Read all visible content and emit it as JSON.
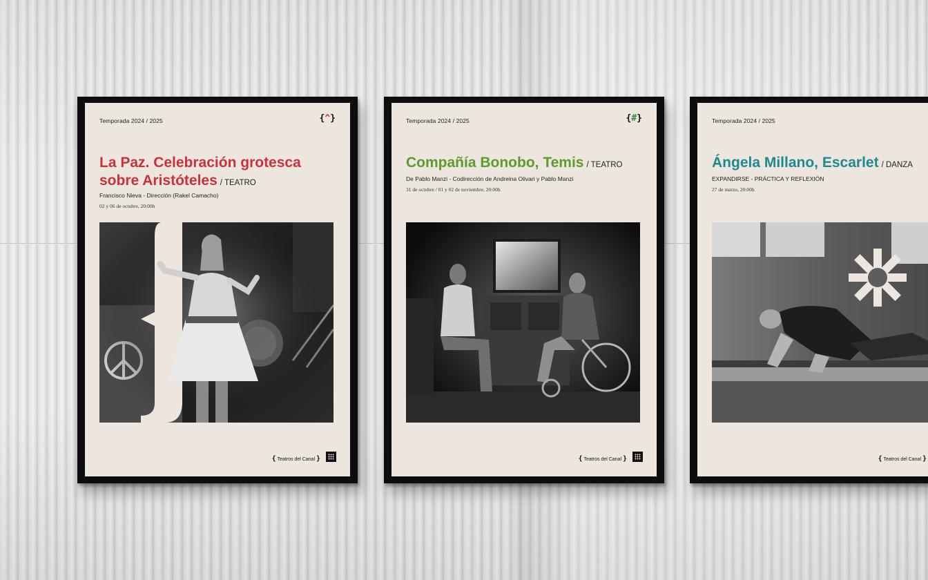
{
  "posters": [
    {
      "season": "Temporada 2024 / 2025",
      "logo": {
        "open": "{",
        "mid": "^",
        "close": "}"
      },
      "title_line1": "La Paz. Celebración grotesca",
      "title_line2": "sobre Aristóteles",
      "category": "/ TEATRO",
      "credit": "Francisco Nieva - Dirección (Rakel Camacho)",
      "dates": "02 y 06 de octubre, 20:00h",
      "footer": "Teatros del Canal",
      "accent": "#c8323a"
    },
    {
      "season": "Temporada 2024 / 2025",
      "logo": {
        "open": "{",
        "mid": "#",
        "close": "}"
      },
      "title_line1": "Compañía Bonobo, Temis",
      "category": "/ TEATRO",
      "credit": "De Pablo Manzi - Codirección de Andreina Olivari y Pablo Manzi",
      "dates": "31 de octubre /  01 y 02 de noviembre, 20:00h",
      "footer": "Teatros del Canal",
      "accent": "#5e9a2c"
    },
    {
      "season": "Temporada 2024 / 2025",
      "title_line1": "Ángela Millano, Escarlet",
      "category": "/ DANZA",
      "credit": "EXPANDIRSE - PRÁCTICA Y REFLEXIÓN",
      "dates": "27 de marzo, 20:00h",
      "footer": "Teatros del Canal",
      "accent": "#1d8a8f"
    }
  ]
}
